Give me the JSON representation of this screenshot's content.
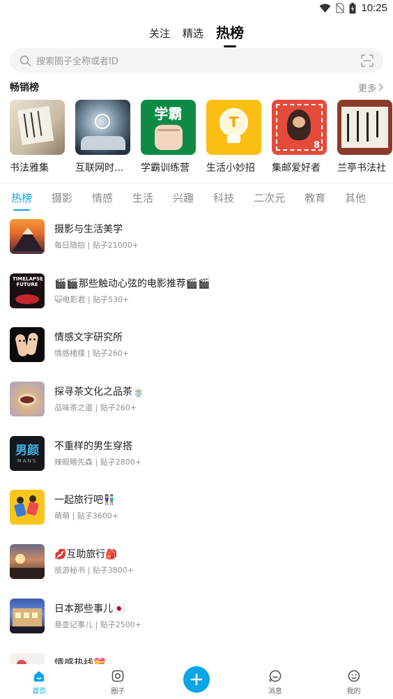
{
  "status_bar": {
    "time": "10:25"
  },
  "top_tabs": [
    {
      "label": "关注"
    },
    {
      "label": "精选"
    },
    {
      "label": "热榜"
    }
  ],
  "search": {
    "placeholder": "搜索圈子全称或者ID"
  },
  "bestseller": {
    "title": "畅销榜",
    "more": "更多",
    "items": [
      {
        "label": "书法雅集"
      },
      {
        "label": "互联网时..."
      },
      {
        "label": "学霸训练营",
        "thumb_text": "学霸"
      },
      {
        "label": "生活小妙招",
        "thumb_text": "T"
      },
      {
        "label": "集邮爱好者",
        "thumb_text": "8"
      },
      {
        "label": "兰亭书法社"
      }
    ]
  },
  "category_tabs": [
    "热榜",
    "摄影",
    "情感",
    "生活",
    "兴趣",
    "科技",
    "二次元",
    "教育",
    "其他"
  ],
  "list": [
    {
      "title": "摄影与生活美学",
      "sub": "每日随拍 | 贴子21000+"
    },
    {
      "title": "🎬🎬那些触动心弦的电影推荐🎬🎬",
      "sub": "🙀电影君 | 贴子530+",
      "thumb_text": "TIMELAPSE FUTURE"
    },
    {
      "title": "情感文字研究所",
      "sub": "情感楮楪 | 贴子260+"
    },
    {
      "title": "探寻茶文化之品茶🍵",
      "sub": "品味茶之道 | 贴子260+"
    },
    {
      "title": "不重样的男生穿搭",
      "sub": "辣眼睛先森 | 贴子2800+",
      "thumb_text": "男颜",
      "thumb_sub": "MANS"
    },
    {
      "title": "一起旅行吧👫🏻",
      "sub": "萌萌 | 贴子3600+"
    },
    {
      "title": "💋互助旅行🎒",
      "sub": "旅游秘书 | 贴子3800+"
    },
    {
      "title": "日本那些事儿🇯🇵",
      "sub": "悬壶记事儿 | 贴子2500+"
    },
    {
      "title": "情感热线💝",
      "sub": ""
    }
  ],
  "bottom_nav": [
    {
      "label": "首页",
      "icon": "home-icon"
    },
    {
      "label": "圈子",
      "icon": "circle-icon"
    },
    {
      "label": "",
      "icon": "add-icon"
    },
    {
      "label": "消息",
      "icon": "message-icon"
    },
    {
      "label": "我的",
      "icon": "profile-icon"
    }
  ],
  "colors": {
    "accent": "#0aa5e6",
    "text": "#222222",
    "muted": "#8e8e8e"
  }
}
